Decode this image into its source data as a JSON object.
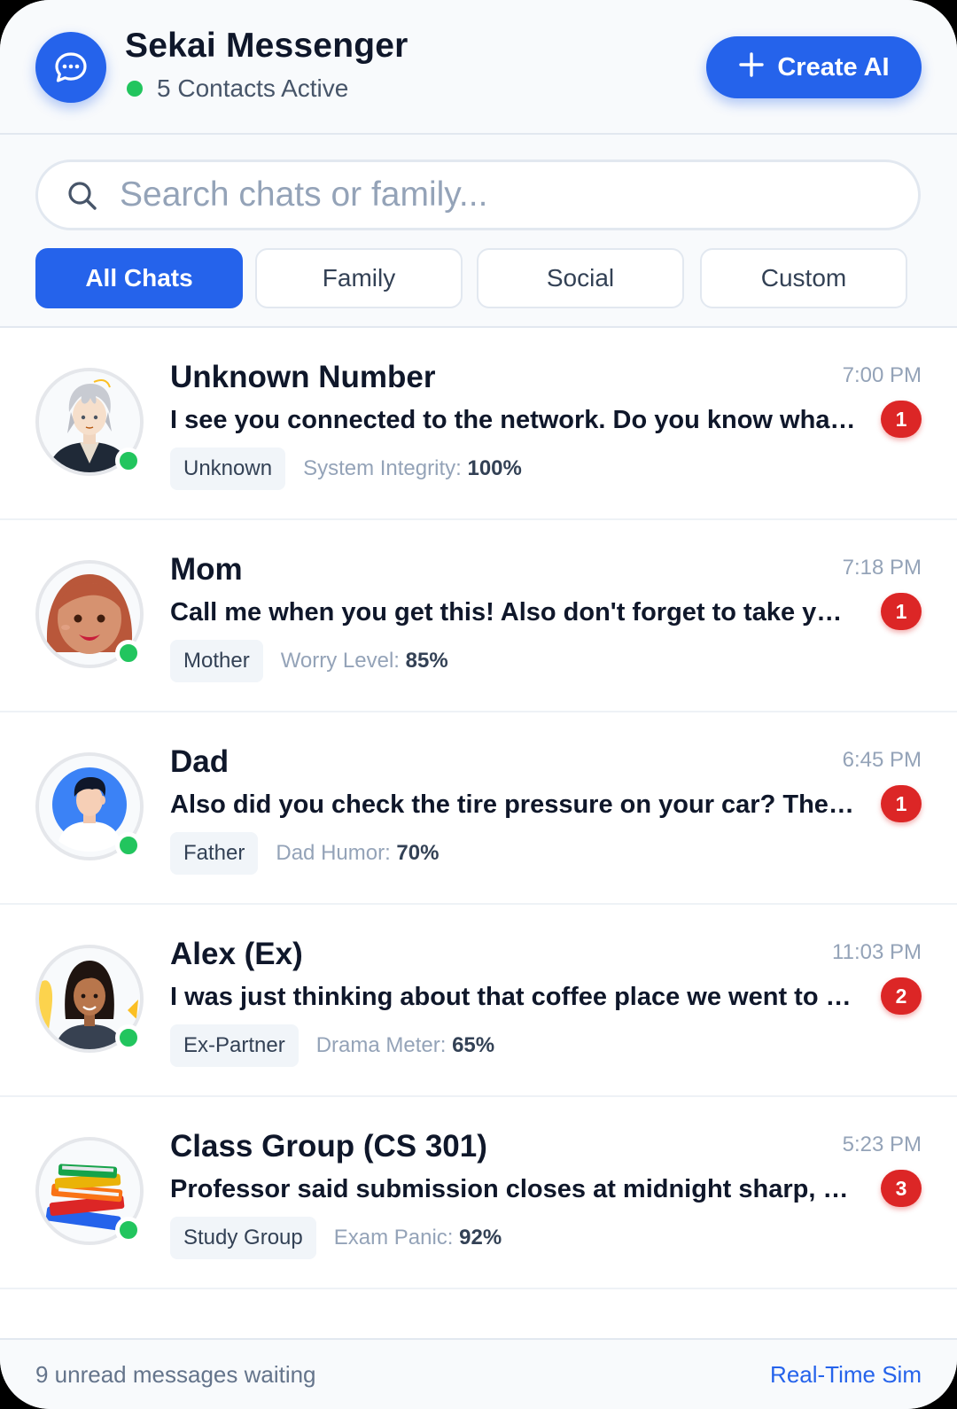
{
  "header": {
    "app_icon": "chat-bubble-icon",
    "title": "Sekai Messenger",
    "active_contacts": "5 Contacts Active",
    "create_button": {
      "icon": "plus-icon",
      "label": "Create AI"
    }
  },
  "search": {
    "placeholder": "Search chats or family...",
    "value": ""
  },
  "tabs": [
    {
      "label": "All Chats",
      "active": true
    },
    {
      "label": "Family",
      "active": false
    },
    {
      "label": "Social",
      "active": false
    },
    {
      "label": "Custom",
      "active": false
    }
  ],
  "chats": [
    {
      "name": "Unknown Number",
      "time": "7:00 PM",
      "message": "I see you connected to the network. Do you know what happens next?",
      "unread": "1",
      "relation": "Unknown",
      "stat_label": "System Integrity:",
      "stat_value": "100%",
      "avatar": "anime-man-avatar",
      "online": true
    },
    {
      "name": "Mom",
      "time": "7:18 PM",
      "message": "Call me when you get this! Also don't forget to take your vitamins",
      "unread": "1",
      "relation": "Mother",
      "stat_label": "Worry Level:",
      "stat_value": "85%",
      "avatar": "woman-face-avatar",
      "online": true
    },
    {
      "name": "Dad",
      "time": "6:45 PM",
      "message": "Also did you check the tire pressure on your car? The cold weather",
      "unread": "1",
      "relation": "Father",
      "stat_label": "Dad Humor:",
      "stat_value": "70%",
      "avatar": "man-profile-avatar",
      "online": true
    },
    {
      "name": "Alex (Ex)",
      "time": "11:03 PM",
      "message": "I was just thinking about that coffee place we went to last summer",
      "unread": "2",
      "relation": "Ex-Partner",
      "stat_label": "Drama Meter:",
      "stat_value": "65%",
      "avatar": "woman-portrait-avatar",
      "online": true
    },
    {
      "name": "Class Group (CS 301)",
      "time": "5:23 PM",
      "message": "Professor said submission closes at midnight sharp, no extensions",
      "unread": "3",
      "relation": "Study Group",
      "stat_label": "Exam Panic:",
      "stat_value": "92%",
      "avatar": "book-stack-avatar",
      "online": true
    }
  ],
  "footer": {
    "unread_summary": "9 unread messages waiting",
    "mode_label": "Real-Time Sim"
  },
  "colors": {
    "accent": "#2563eb",
    "online": "#22c55e",
    "badge": "#dc2626"
  }
}
